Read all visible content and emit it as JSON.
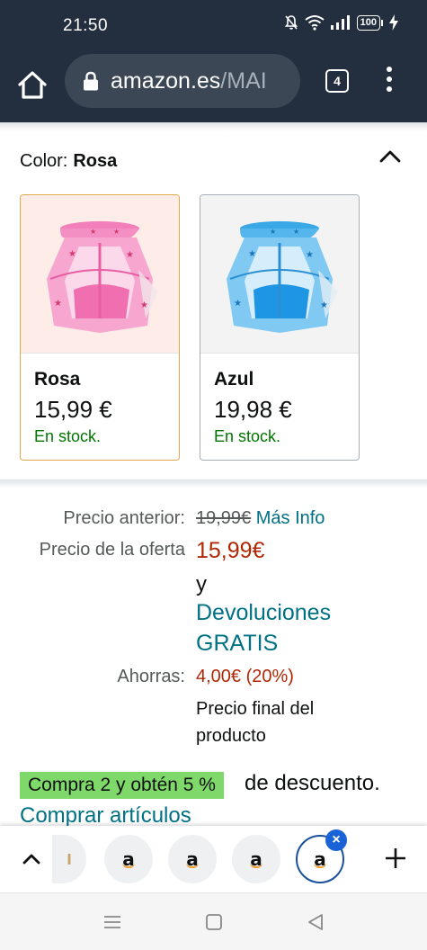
{
  "status_bar": {
    "time": "21:50",
    "battery": "100",
    "icons": [
      "mute-bell-icon",
      "wifi-icon",
      "signal-icon",
      "battery-icon",
      "charging-icon"
    ]
  },
  "browser": {
    "url_host": "amazon.es",
    "url_path": "/MAI",
    "tab_count": "4"
  },
  "color_selector": {
    "label": "Color:",
    "selected": "Rosa",
    "options": [
      {
        "name": "Rosa",
        "price": "15,99 €",
        "stock": "En stock."
      },
      {
        "name": "Azul",
        "price": "19,98 €",
        "stock": "En stock."
      }
    ]
  },
  "pricing": {
    "previous_label": "Precio anterior:",
    "previous_price": "19,99€",
    "more_info": "Más Info",
    "offer_label": "Precio de la oferta",
    "offer_price": "15,99€",
    "and_text": "y",
    "returns_line1": "Devoluciones",
    "returns_line2": "GRATIS",
    "savings_label": "Ahorras:",
    "savings_value": "4,00€ (20%)",
    "final_line1": "Precio final del",
    "final_line2": "producto"
  },
  "promo": {
    "badge": "Compra 2 y obtén 5 %",
    "text": "de descuento.",
    "link": "Comprar artículos"
  },
  "tab_strip": {
    "tab_letters": [
      "a",
      "a",
      "a",
      "a"
    ]
  },
  "colors": {
    "header_bg": "#232f3e",
    "link": "#007185",
    "deal_red": "#b12704",
    "in_stock": "#007600",
    "promo_green": "#7fd96a",
    "selected_border": "#e0a94a"
  }
}
